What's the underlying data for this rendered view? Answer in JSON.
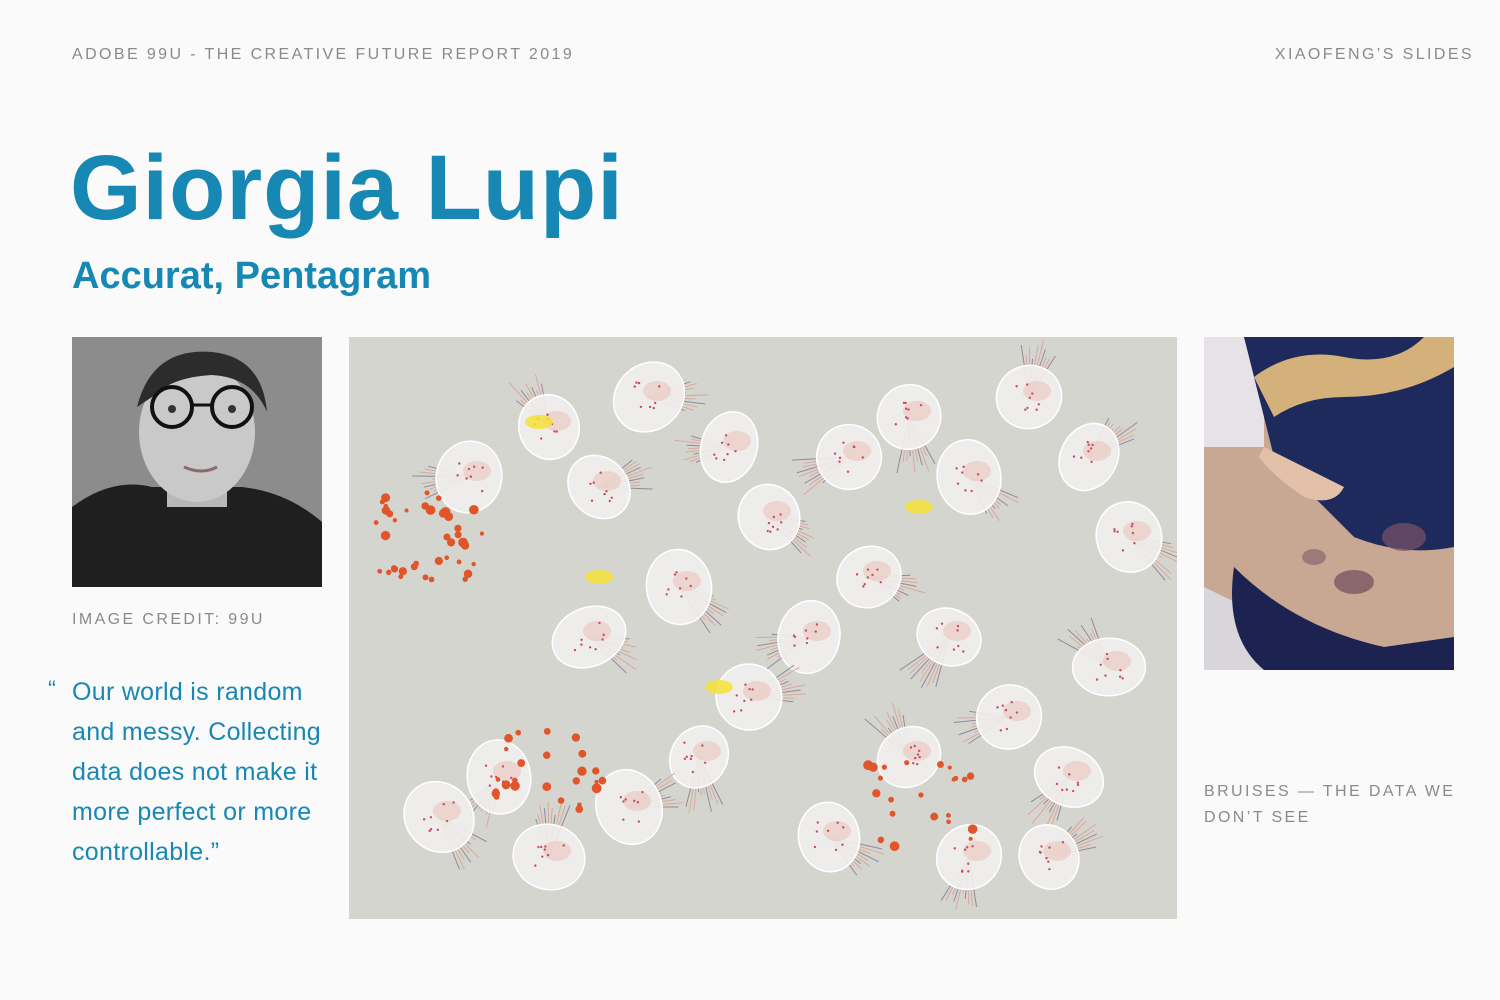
{
  "header": {
    "left": "ADOBE 99U - THE CREATIVE FUTURE REPORT 2019",
    "right": "XIAOFENG’S SLIDES"
  },
  "title": "Giorgia Lupi",
  "subtitle": "Accurat, Pentagram",
  "portrait": {
    "credit": "IMAGE CREDIT: 99U"
  },
  "quote": {
    "mark": "“",
    "text": "Our world is random and messy. Collecting data does not make it more perfect or more controllable.”"
  },
  "bruise_photo": {
    "caption": "BRUISES — THE DATA WE DON’T SEE"
  },
  "colors": {
    "accent": "#1787b3",
    "muted": "#8a8a8a",
    "background": "#fafafa",
    "artwork_bg": "#d5d5d0"
  }
}
